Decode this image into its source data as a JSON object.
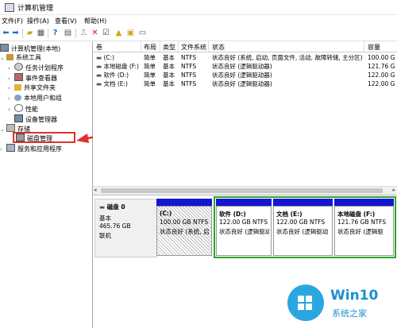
{
  "window": {
    "title": "计算机管理"
  },
  "menu": [
    "文件(F)",
    "操作(A)",
    "查看(V)",
    "帮助(H)"
  ],
  "tree": [
    {
      "label": "计算机管理(本地)",
      "icon": "computer-icon",
      "level": 0,
      "expanded": true
    },
    {
      "label": "系统工具",
      "icon": "tools-icon",
      "level": 1,
      "expanded": true
    },
    {
      "label": "任务计划程序",
      "icon": "clock-icon",
      "level": 2,
      "expanded": false
    },
    {
      "label": "事件查看器",
      "icon": "event-icon",
      "level": 2,
      "expanded": false
    },
    {
      "label": "共享文件夹",
      "icon": "folder-icon",
      "level": 2,
      "expanded": false
    },
    {
      "label": "本地用户和组",
      "icon": "users-icon",
      "level": 2,
      "expanded": false
    },
    {
      "label": "性能",
      "icon": "performance-icon",
      "level": 2,
      "expanded": false
    },
    {
      "label": "设备管理器",
      "icon": "device-icon",
      "level": 2,
      "expanded": null
    },
    {
      "label": "存储",
      "icon": "storage-icon",
      "level": 1,
      "expanded": true
    },
    {
      "label": "磁盘管理",
      "icon": "disk-icon",
      "level": 2,
      "expanded": null,
      "selected": true
    },
    {
      "label": "服务和应用程序",
      "icon": "services-icon",
      "level": 1,
      "expanded": false
    }
  ],
  "table": {
    "columns": [
      "卷",
      "布局",
      "类型",
      "文件系统",
      "状态",
      "容量"
    ],
    "rows": [
      [
        "(C:)",
        "简单",
        "基本",
        "NTFS",
        "状态良好 (系统, 启动, 页面文件, 活动, 故障转储, 主分区)",
        "100.00 G"
      ],
      [
        "本地磁盘 (F:)",
        "简单",
        "基本",
        "NTFS",
        "状态良好 (逻辑驱动器)",
        "121.76 G"
      ],
      [
        "软件 (D:)",
        "简单",
        "基本",
        "NTFS",
        "状态良好 (逻辑驱动器)",
        "122.00 G"
      ],
      [
        "文档 (E:)",
        "简单",
        "基本",
        "NTFS",
        "状态良好 (逻辑驱动器)",
        "122.00 G"
      ]
    ]
  },
  "disk": {
    "name": "磁盘 0",
    "type": "基本",
    "size": "465.76 GB",
    "status": "联机",
    "partitions": [
      {
        "title": "(C:)",
        "size": "100.00 GB NTFS",
        "status": "状态良好 (系统, 启"
      },
      {
        "title": "软件  (D:)",
        "size": "122.00 GB NTFS",
        "status": "状态良好 (逻辑驱动"
      },
      {
        "title": "文档  (E:)",
        "size": "122.00 GB NTFS",
        "status": "状态良好 (逻辑驱动"
      },
      {
        "title": "本地磁盘  (F:)",
        "size": "121.76 GB NTFS",
        "status": "状态良好 (逻辑驱"
      }
    ]
  },
  "watermark": {
    "line1": "Win10",
    "line2": "系统之家"
  },
  "colors": {
    "partition_bar": "#1515d4",
    "highlight_red": "#e0312a",
    "extended_green": "#2ea52e",
    "logo_blue": "#2aa7e0"
  }
}
